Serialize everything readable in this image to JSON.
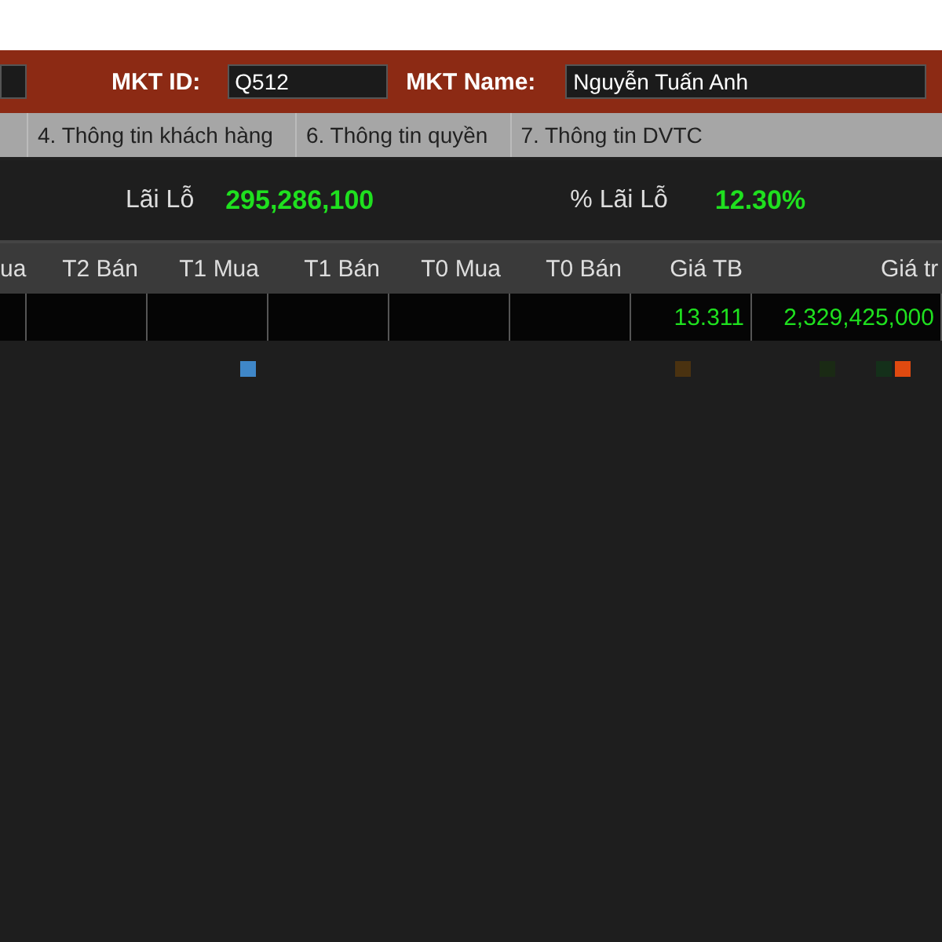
{
  "header": {
    "id_label": "MKT ID:",
    "id_value": "Q512",
    "name_label": "MKT Name:",
    "name_value": "Nguyễn Tuấn Anh"
  },
  "tabs": [
    {
      "label": "4. Thông tin khách hàng",
      "selected": false
    },
    {
      "label": "6. Thông tin quyền",
      "selected": false
    },
    {
      "label": "7. Thông tin DVTC",
      "selected": false
    }
  ],
  "summary": [
    {
      "label": "Lãi Lỗ",
      "value": "295,286,100"
    },
    {
      "label": "% Lãi Lỗ",
      "value": "12.30%"
    }
  ],
  "table": {
    "columns": [
      "ua",
      "T2 Bán",
      "T1 Mua",
      "T1 Bán",
      "T0 Mua",
      "T0 Bán",
      "Giá TB",
      "Giá tr"
    ],
    "rows": [
      [
        "",
        "",
        "",
        "",
        "",
        "",
        "13.311",
        "2,329,425,000"
      ]
    ]
  },
  "markers": [
    {
      "color": "#3f87c8"
    },
    {
      "color": "#4a3210"
    },
    {
      "color": "#1a2a14"
    },
    {
      "color": "#14301a"
    },
    {
      "color": "#e04a10"
    }
  ]
}
